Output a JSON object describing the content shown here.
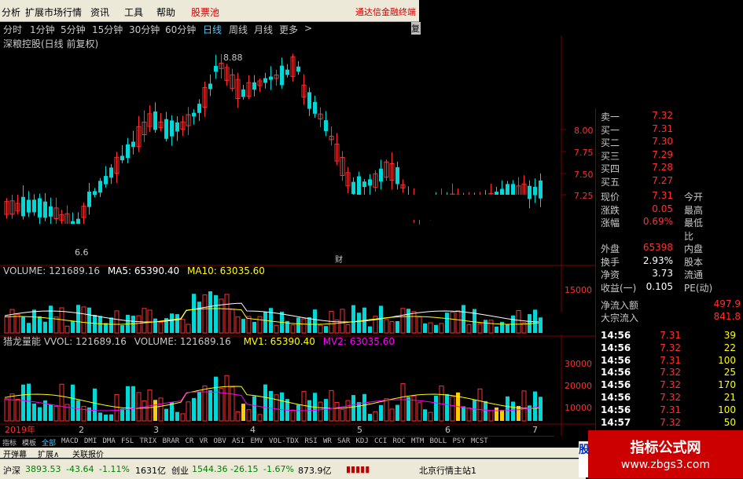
{
  "menu": {
    "items": [
      "分析",
      "扩展市场行情",
      "资讯",
      "工具",
      "帮助",
      "股票池"
    ],
    "right_text": "通达信金融终端"
  },
  "periods": {
    "items": [
      "分时",
      "1分钟",
      "5分钟",
      "15分钟",
      "30分钟",
      "60分钟",
      "日线",
      "周线",
      "月线",
      "更多"
    ],
    "active": "日线",
    "arrow": ">",
    "right_tab": "复"
  },
  "main_chart": {
    "title": "深粮控股(日线 前复权)",
    "high_label": "8.88",
    "low_label": "6.6",
    "price_ticks": [
      "8.00",
      "7.75",
      "7.50",
      "7.25"
    ],
    "markers": [
      "财"
    ]
  },
  "volume_panel": {
    "label": "VOLUME: 121689.16",
    "ma5": "MA5: 65390.40",
    "ma10": "MA10: 63035.60",
    "ticks": [
      "15000"
    ]
  },
  "vvol_panel": {
    "label": "猎龙量能 VVOL: 121689.16",
    "volume": "VOLUME: 121689.16",
    "mv1": "MV1: 65390.40",
    "mv2": "MV2: 63035.60",
    "ticks": [
      "30000",
      "20000",
      "10000"
    ]
  },
  "x_axis": {
    "year": "2019年",
    "months": [
      "2",
      "3",
      "4",
      "5",
      "6",
      "7"
    ]
  },
  "indicators": {
    "items": [
      "指标",
      "模板",
      "全部",
      "MACD",
      "DMI",
      "DMA",
      "FSL",
      "TRIX",
      "BRAR",
      "CR",
      "VR",
      "OBV",
      "ASI",
      "EMV",
      "VOL-TDX",
      "RSI",
      "WR",
      "SAR",
      "KDJ",
      "CCI",
      "ROC",
      "MTM",
      "BOLL",
      "PSY",
      "MCST"
    ],
    "active": "全部"
  },
  "subbar": {
    "items": [
      "开弹幕",
      "扩展∧",
      "关联报价"
    ]
  },
  "statusbar": {
    "sh_label": "沪深",
    "sh_index": "3893.53",
    "sh_change": "-43.64",
    "sh_pct": "-1.11%",
    "sh_amount": "1631亿",
    "cy_label": "创业",
    "cy_index": "1544.36",
    "cy_change": "-26.15",
    "cy_pct": "-1.67%",
    "cy_amount": "873.9亿",
    "server": "北京行情主站1"
  },
  "quote": {
    "orderbook": [
      {
        "label": "卖一",
        "price": "7.32"
      },
      {
        "label": "买一",
        "price": "7.31"
      },
      {
        "label": "买二",
        "price": "7.30"
      },
      {
        "label": "买三",
        "price": "7.29"
      },
      {
        "label": "买四",
        "price": "7.28"
      },
      {
        "label": "买五",
        "price": "7.27"
      }
    ],
    "stats": [
      {
        "label": "现价",
        "value": "7.31",
        "label2": "今开"
      },
      {
        "label": "涨跌",
        "value": "0.05",
        "label2": "最高"
      },
      {
        "label": "涨幅",
        "value": "0.69%",
        "label2": "最低"
      },
      {
        "label": "",
        "value": "",
        "label2": "比"
      },
      {
        "label": "外盘",
        "value": "65398",
        "label2": "内盘"
      },
      {
        "label": "换手",
        "value": "2.93%",
        "label2": "股本"
      },
      {
        "label": "净资",
        "value": "3.73",
        "label2": "流通"
      },
      {
        "label": "收益(一)",
        "value": "0.105",
        "label2": "PE(动)"
      }
    ],
    "flow": [
      {
        "label": "净流入额",
        "value": "497.9"
      },
      {
        "label": "大宗流入",
        "value": "841.8"
      }
    ],
    "ticks": [
      {
        "time": "14:56",
        "price": "7.31",
        "vol": "39"
      },
      {
        "time": "14:56",
        "price": "7.32",
        "vol": "22"
      },
      {
        "time": "14:56",
        "price": "7.31",
        "vol": "100"
      },
      {
        "time": "14:56",
        "price": "7.32",
        "vol": "25"
      },
      {
        "time": "14:56",
        "price": "7.32",
        "vol": "170"
      },
      {
        "time": "14:56",
        "price": "7.32",
        "vol": "21"
      },
      {
        "time": "14:56",
        "price": "7.31",
        "vol": "100"
      },
      {
        "time": "14:57",
        "price": "7.32",
        "vol": "50"
      }
    ]
  },
  "logo": {
    "title": "指标公式网",
    "url": "www.zbgs3.com",
    "side_char": "股"
  },
  "colors": {
    "up": "#ff3030",
    "down": "#00d8d8",
    "ma5": "#ffffff",
    "ma10": "#ffff00",
    "mv2": "#ff00ff",
    "active_tab": "#4fc8ff"
  }
}
